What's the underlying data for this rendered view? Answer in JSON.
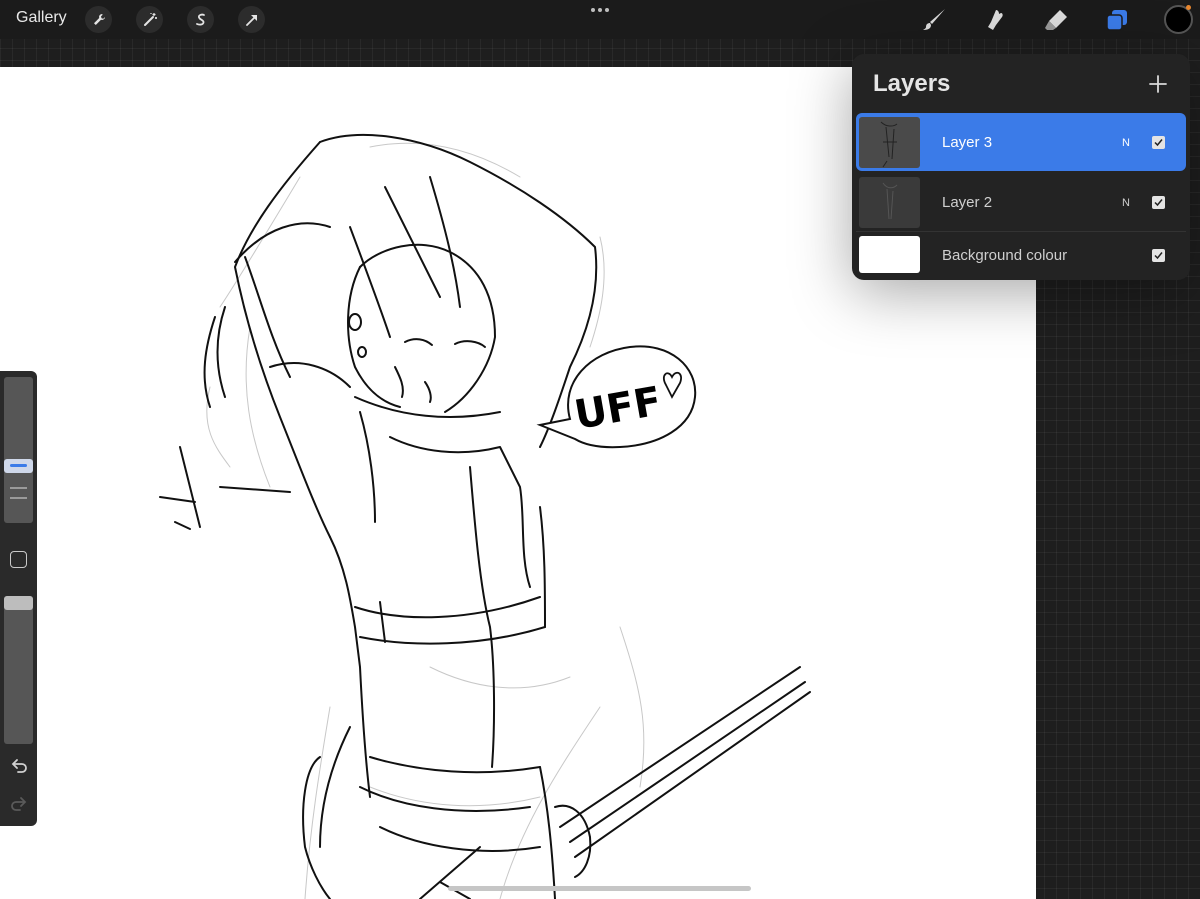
{
  "topbar": {
    "gallery_label": "Gallery",
    "left_tools": [
      "wrench-icon",
      "magic-wand-icon",
      "selection-s-icon",
      "transform-arrow-icon"
    ],
    "right_tools": [
      "brush-icon",
      "smudge-icon",
      "eraser-icon",
      "layers-icon"
    ],
    "active_tool": "layers-icon",
    "current_color": "#000000",
    "accent_color": "#3b7be8"
  },
  "canvas": {
    "speech_bubble_text": "UFF"
  },
  "sidebar": {
    "brush_size_level": 0.2,
    "opacity_level": 0.1,
    "icons": [
      "modify-square-icon",
      "undo-icon",
      "redo-icon"
    ]
  },
  "layers_panel": {
    "title": "Layers",
    "add_icon": "plus-icon",
    "layers": [
      {
        "name": "Layer 3",
        "blend": "N",
        "visible": true,
        "active": true
      },
      {
        "name": "Layer 2",
        "blend": "N",
        "visible": true,
        "active": false
      },
      {
        "name": "Background colour",
        "blend": "",
        "visible": true,
        "active": false
      }
    ]
  }
}
